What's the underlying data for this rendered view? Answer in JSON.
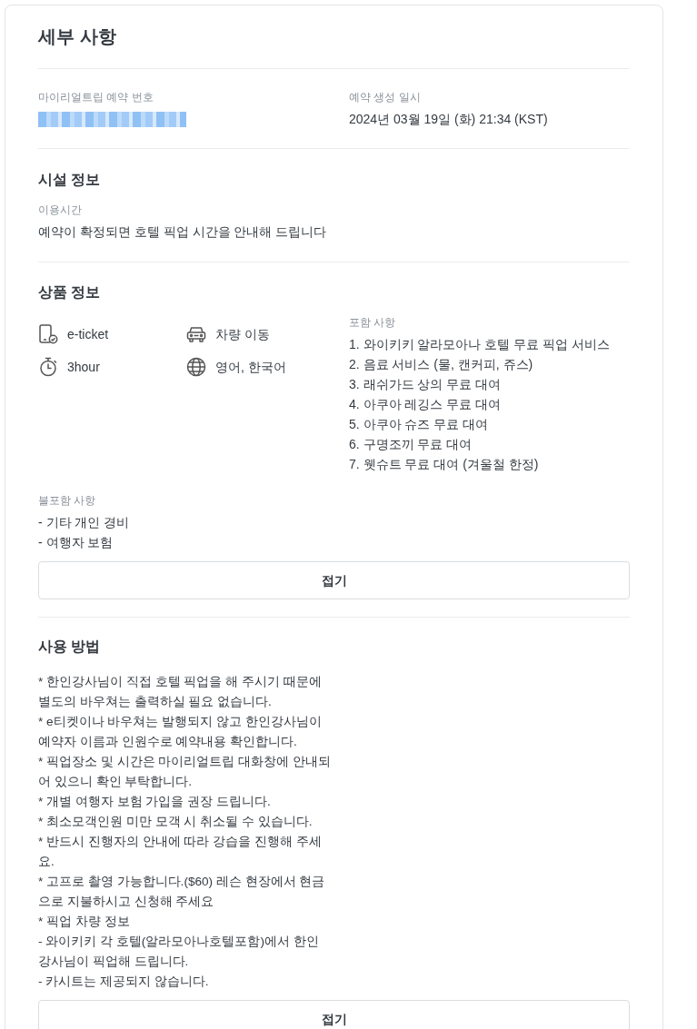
{
  "title": "세부 사항",
  "booking": {
    "number_label": "마이리얼트립 예약 번호",
    "created_label": "예약 생성 일시",
    "created_value": "2024년 03월 19일 (화) 21:34 (KST)"
  },
  "facility": {
    "heading": "시설 정보",
    "label": "이용시간",
    "value": "예약이 확정되면 호텔 픽업 시간을 안내해 드립니다"
  },
  "product": {
    "heading": "상품 정보",
    "features": [
      {
        "kind": "ticket",
        "text": "e-ticket"
      },
      {
        "kind": "car",
        "text": "차량 이동"
      },
      {
        "kind": "timer",
        "text": "3hour"
      },
      {
        "kind": "language",
        "text": "영어, 한국어"
      }
    ],
    "included_label": "포함 사항",
    "included": [
      "1. 와이키키 알라모아나 호텔 무료 픽업 서비스",
      "2. 음료 서비스 (물, 캔커피, 쥬스)",
      "3. 래쉬가드 상의 무료 대여",
      "4. 아쿠아 레깅스 무료 대여",
      "5. 아쿠아 슈즈 무료 대여",
      "6. 구명조끼 무료 대여",
      "7. 웻슈트 무료 대여 (겨울철 한정)"
    ],
    "excluded_label": "불포함 사항",
    "excluded": [
      "- 기타 개인 경비",
      "- 여행자 보험"
    ],
    "collapse_button": "접기"
  },
  "usage": {
    "heading": "사용 방법",
    "lines": [
      "* 한인강사님이 직접 호텔 픽업을 해 주시기 때문에 별도의 바우쳐는 출력하실 필요 없습니다.",
      "* e티켓이나 바우쳐는 발행되지 않고 한인강사님이 예약자 이름과 인원수로 예약내용 확인합니다.",
      "* 픽업장소 및 시간은 마이리얼트립 대화창에 안내되어 있으니 확인 부탁합니다.",
      "* 개별 여행자 보험 가입을 권장 드립니다.",
      "* 최소모객인원 미만 모객 시 취소될 수 있습니다.",
      "* 반드시 진행자의 안내에 따라 강습을 진행해 주세요.",
      "* 고프로 촬영 가능합니다.($60) 레슨 현장에서 현금으로 지불하시고 신청해 주세요",
      "* 픽업 차량 정보",
      "- 와이키키 각 호텔(알라모아나호텔포함)에서 한인 강사님이 픽업해 드립니다.",
      "- 카시트는 제공되지 않습니다."
    ],
    "collapse_button": "접기"
  }
}
